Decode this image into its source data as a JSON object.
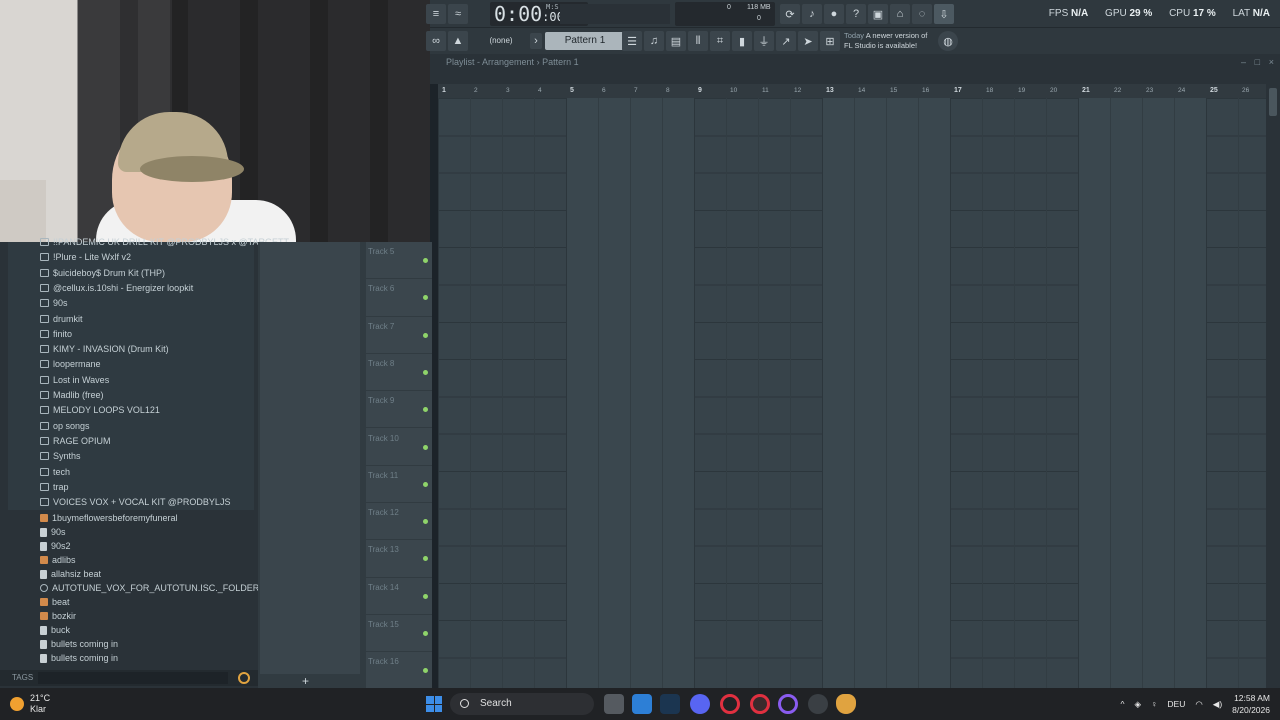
{
  "colors": {
    "accent_green": "#8fd46a",
    "fl_orange": "#e0a340",
    "win_blue": "#3d8ee8"
  },
  "transport": {
    "time": "0:00",
    "time_small": ":00",
    "time_unit": "M:S:CS",
    "memory": "118 MB",
    "mem_val1": "0",
    "mem_val2": "0"
  },
  "pattern": {
    "none_label": "(none)",
    "selected": "Pattern 1"
  },
  "update": {
    "today": "Today",
    "message_1": "A newer version of",
    "message_2": "FL Studio is available!"
  },
  "stats": {
    "fps_label": "FPS",
    "fps_val": "N/A",
    "gpu_label": "GPU",
    "gpu_val": "29 %",
    "cpu_label": "CPU",
    "cpu_val": "17 %",
    "lat_label": "LAT",
    "lat_val": "N/A"
  },
  "playlist": {
    "title": "Playlist - Arrangement",
    "sep": "›",
    "pattern": "Pattern 1",
    "ruler": [
      "1",
      "2",
      "3",
      "4",
      "5",
      "6",
      "7",
      "8",
      "9",
      "10",
      "11",
      "12",
      "13",
      "14",
      "15",
      "16",
      "17",
      "18",
      "19",
      "20",
      "21",
      "22",
      "23",
      "24",
      "25",
      "26"
    ],
    "tracks": [
      "Track 5",
      "Track 6",
      "Track 7",
      "Track 8",
      "Track 9",
      "Track 10",
      "Track 11",
      "Track 12",
      "Track 13",
      "Track 14",
      "Track 15",
      "Track 16"
    ]
  },
  "browser": {
    "folders": [
      "!!PANDEMIC UK DRILL KIT @PRODBYLJS x @TARGETT",
      "!Plure - Lite Wxlf v2",
      "$uicideboy$ Drum Kit (THP)",
      "@cellux.is.10shi - Energizer loopkit",
      "90s",
      "drumkit",
      "finito",
      "KIMY - INVASION (Drum Kit)",
      "loopermane",
      "Lost in Waves",
      "Madlib (free)",
      "MELODY LOOPS VOL121",
      "op songs",
      "RAGE OPIUM",
      "Synths",
      "tech",
      "trap",
      "VOICES VOX + VOCAL KIT @PRODBYLJS"
    ],
    "files": [
      {
        "name": "1buymeflowersbeforemyfuneral",
        "icon": "audio-icon"
      },
      {
        "name": "90s",
        "icon": "file-icon"
      },
      {
        "name": "90s2",
        "icon": "file-icon"
      },
      {
        "name": "adlibs",
        "icon": "audio-icon"
      },
      {
        "name": "allahsiz beat",
        "icon": "file-icon"
      },
      {
        "name": "AUTOTUNE_VOX_FOR_AUTOTUN.ISC._FOLDER_IN_THIS_KIT",
        "icon": "gear-icon"
      },
      {
        "name": "beat",
        "icon": "audio-icon"
      },
      {
        "name": "bozkir",
        "icon": "audio-icon"
      },
      {
        "name": "buck",
        "icon": "file-icon"
      },
      {
        "name": "bullets coming in",
        "icon": "file-icon"
      },
      {
        "name": "bullets coming in",
        "icon": "file-icon"
      }
    ],
    "tags_label": "TAGS"
  },
  "taskbar": {
    "weather_temp": "21°C",
    "weather_desc": "Klar",
    "search": "Search",
    "lang": "DEU",
    "time": "12:58 AM",
    "date": "8/20/2026"
  }
}
